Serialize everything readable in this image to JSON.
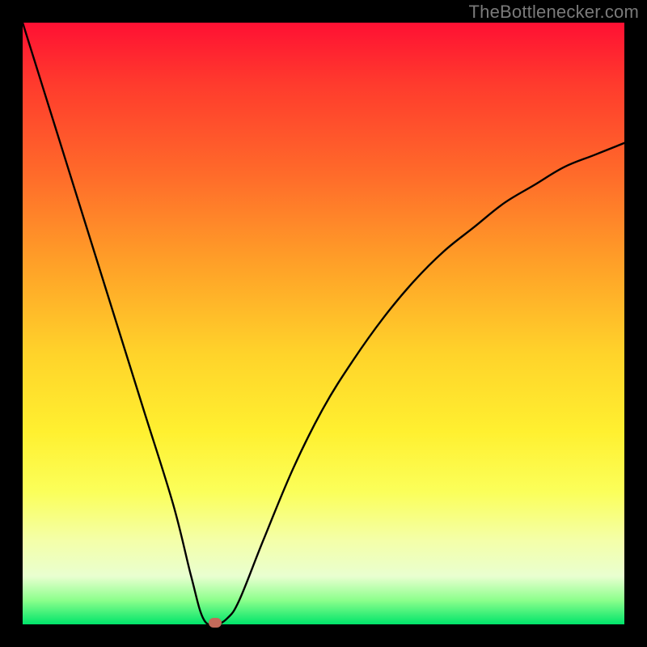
{
  "watermark": "TheBottlenecker.com",
  "chart_data": {
    "type": "line",
    "title": "",
    "xlabel": "",
    "ylabel": "",
    "xlim": [
      0,
      100
    ],
    "ylim": [
      0,
      100
    ],
    "series": [
      {
        "name": "bottleneck-curve",
        "x": [
          0,
          5,
          10,
          15,
          20,
          25,
          28,
          30,
          32,
          34,
          36,
          40,
          45,
          50,
          55,
          60,
          65,
          70,
          75,
          80,
          85,
          90,
          95,
          100
        ],
        "y": [
          100,
          84,
          68,
          52,
          36,
          20,
          8,
          1,
          0,
          1,
          4,
          14,
          26,
          36,
          44,
          51,
          57,
          62,
          66,
          70,
          73,
          76,
          78,
          80
        ]
      }
    ],
    "marker": {
      "x": 32,
      "y": 0
    },
    "gradient_stops": [
      {
        "pos": 0.0,
        "color": "#ff1033"
      },
      {
        "pos": 0.25,
        "color": "#ff6a2a"
      },
      {
        "pos": 0.55,
        "color": "#ffd32a"
      },
      {
        "pos": 0.78,
        "color": "#fbff5a"
      },
      {
        "pos": 0.96,
        "color": "#8cff8c"
      },
      {
        "pos": 1.0,
        "color": "#00e46a"
      }
    ]
  }
}
